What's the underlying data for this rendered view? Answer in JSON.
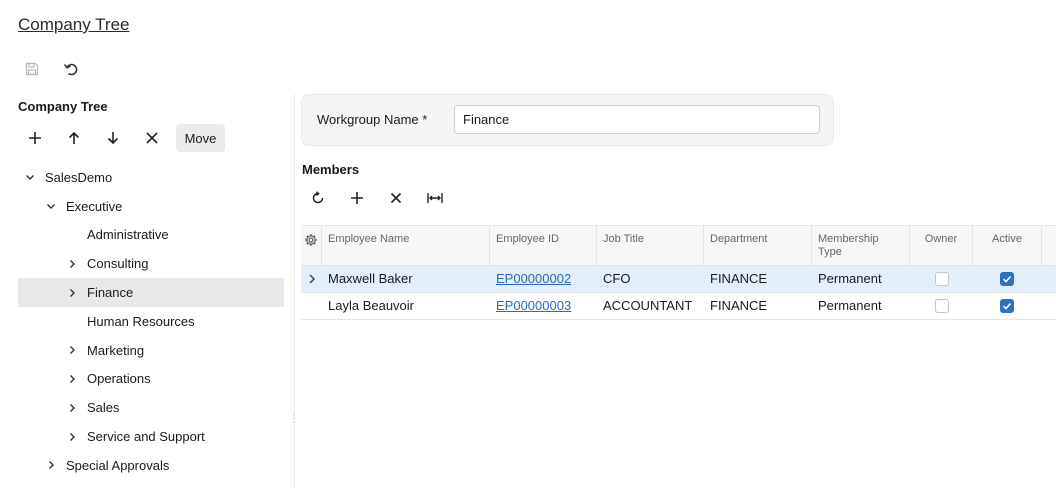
{
  "page": {
    "title": "Company Tree"
  },
  "top_toolbar": [
    {
      "name": "save-icon",
      "label": "Save"
    },
    {
      "name": "undo-icon",
      "label": "Undo"
    }
  ],
  "tree_panel": {
    "title": "Company Tree",
    "toolbar": {
      "add_icon": "plus-icon",
      "up_icon": "arrow-up-icon",
      "down_icon": "arrow-down-icon",
      "delete_icon": "close-icon",
      "move_label": "Move"
    },
    "nodes": [
      {
        "label": "SalesDemo",
        "level": 0,
        "chevron": "down",
        "selected": false
      },
      {
        "label": "Executive",
        "level": 1,
        "chevron": "down",
        "selected": false
      },
      {
        "label": "Administrative",
        "level": 2,
        "chevron": "none",
        "selected": false
      },
      {
        "label": "Consulting",
        "level": 2,
        "chevron": "right",
        "selected": false
      },
      {
        "label": "Finance",
        "level": 2,
        "chevron": "right",
        "selected": true
      },
      {
        "label": "Human Resources",
        "level": 2,
        "chevron": "none",
        "selected": false
      },
      {
        "label": "Marketing",
        "level": 2,
        "chevron": "right",
        "selected": false
      },
      {
        "label": "Operations",
        "level": 2,
        "chevron": "right",
        "selected": false
      },
      {
        "label": "Sales",
        "level": 2,
        "chevron": "right",
        "selected": false
      },
      {
        "label": "Service and Support",
        "level": 2,
        "chevron": "right",
        "selected": false
      },
      {
        "label": "Special Approvals",
        "level": 1,
        "chevron": "right",
        "selected": false
      }
    ]
  },
  "form": {
    "workgroup_label": "Workgroup Name *",
    "workgroup_value": "Finance"
  },
  "members": {
    "title": "Members",
    "toolbar": [
      "refresh-icon",
      "plus-icon",
      "close-icon",
      "fit-width-icon"
    ],
    "columns": [
      "Employee Name",
      "Employee ID",
      "Job Title",
      "Department",
      "Membership Type",
      "Owner",
      "Active"
    ],
    "rows": [
      {
        "name": "Maxwell Baker",
        "id": "EP00000002",
        "job": "CFO",
        "dept": "FINANCE",
        "type": "Permanent",
        "owner": false,
        "active": true
      },
      {
        "name": "Layla Beauvoir",
        "id": "EP00000003",
        "job": "ACCOUNTANT",
        "dept": "FINANCE",
        "type": "Permanent",
        "owner": false,
        "active": true
      }
    ]
  },
  "colors": {
    "accent": "#2f6fc4",
    "selected_tree_row": "#e8e8e8",
    "active_grid_row": "#e2eefa",
    "link": "#2a6cb8"
  }
}
